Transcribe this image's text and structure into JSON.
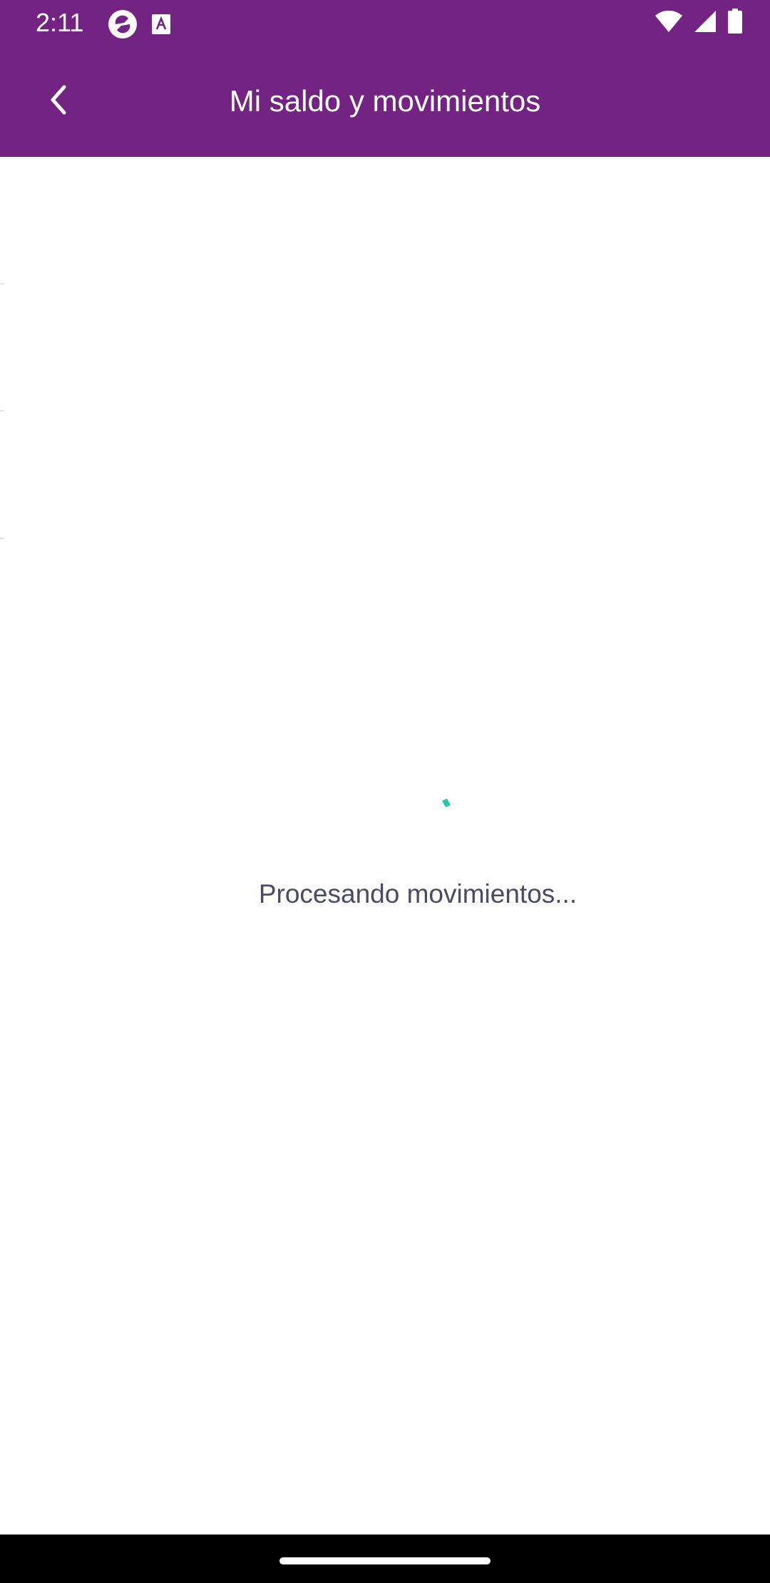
{
  "status_bar": {
    "time": "2:11",
    "left_icons": [
      "app-notification-icon",
      "keyboard-a-icon"
    ],
    "right_icons": [
      "wifi-icon",
      "cell-signal-icon",
      "battery-icon"
    ]
  },
  "app_bar": {
    "title": "Mi saldo y movimientos",
    "back_icon": "chevron-left-icon",
    "background_color": "#732382"
  },
  "loading": {
    "message": "Procesando movimientos...",
    "spinner_color": "#1fc7a8"
  }
}
